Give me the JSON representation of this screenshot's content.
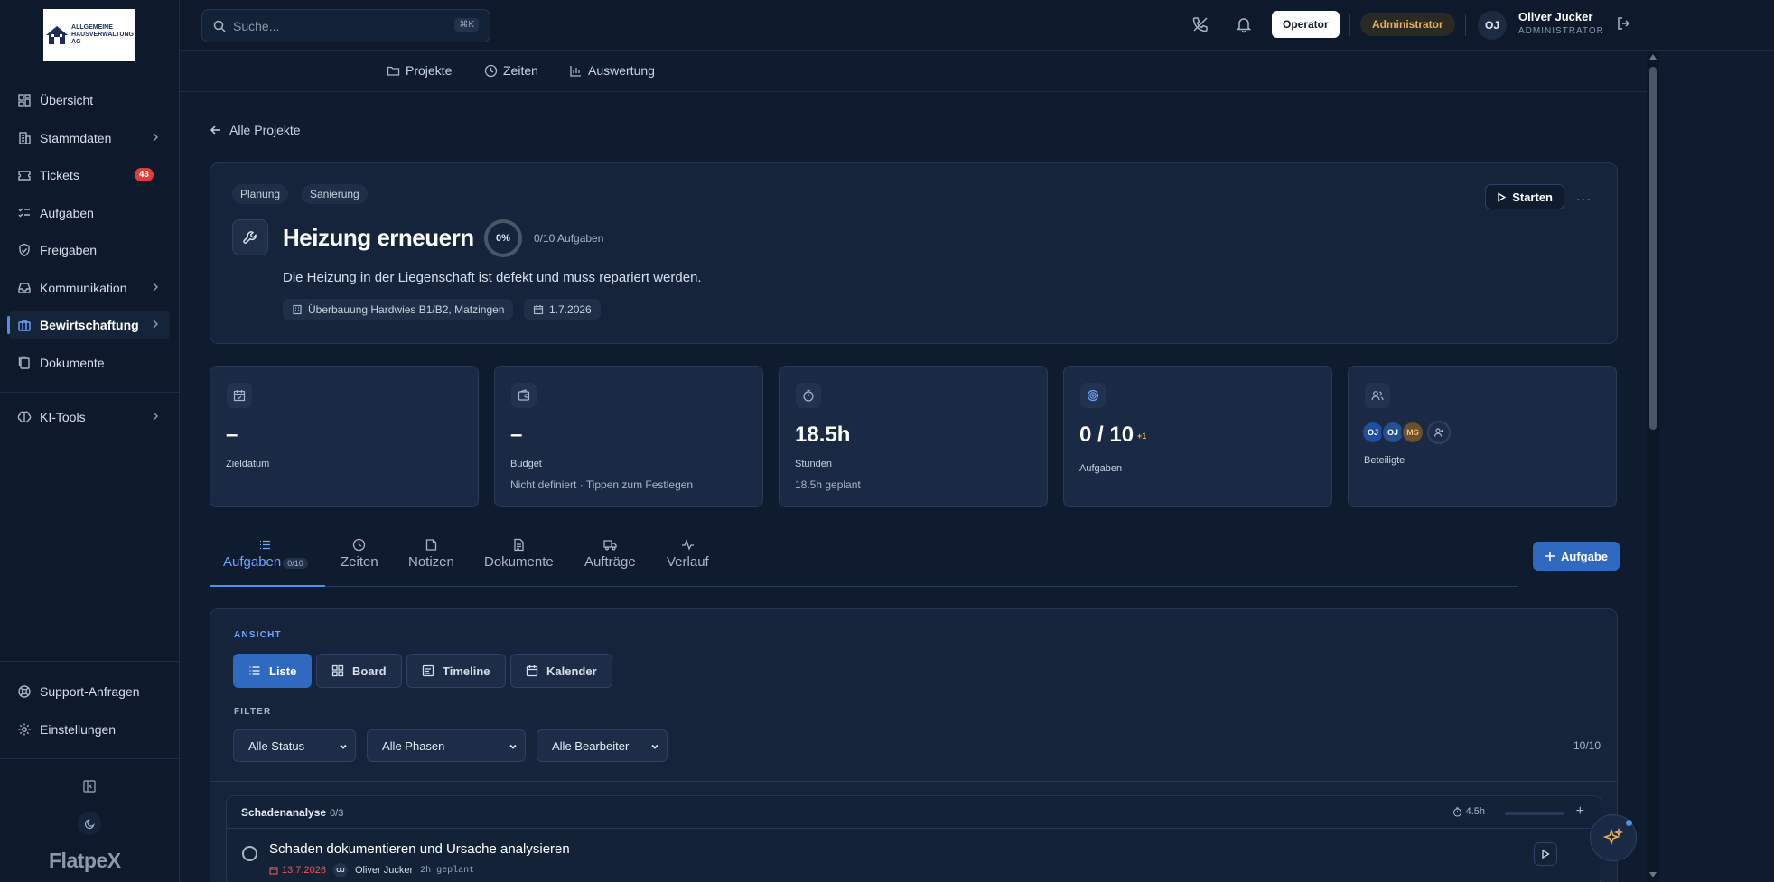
{
  "logo": {
    "line1": "ALLGEMEINE",
    "line2": "HAUSVERWALTUNG",
    "line3": "AG"
  },
  "sidebar": {
    "items": [
      {
        "label": "Übersicht",
        "icon": "dashboard-icon"
      },
      {
        "label": "Stammdaten",
        "icon": "building-icon"
      },
      {
        "label": "Tickets",
        "icon": "ticket-icon",
        "badge": "43"
      },
      {
        "label": "Aufgaben",
        "icon": "task-list-icon"
      },
      {
        "label": "Freigaben",
        "icon": "shield-check-icon"
      },
      {
        "label": "Kommunikation",
        "icon": "inbox-icon"
      },
      {
        "label": "Bewirtschaftung",
        "icon": "briefcase-icon",
        "active": true
      },
      {
        "label": "Dokumente",
        "icon": "documents-icon"
      },
      {
        "label": "KI-Tools",
        "icon": "brain-icon"
      }
    ],
    "bottom": [
      {
        "label": "Support-Anfragen",
        "icon": "lifebuoy-icon"
      },
      {
        "label": "Einstellungen",
        "icon": "gear-icon"
      }
    ],
    "brand": "FlatpeX"
  },
  "topbar": {
    "search_placeholder": "Suche...",
    "search_shortcut": "⌘K",
    "operator_label": "Operator",
    "admin_label": "Administrator",
    "user_initials": "OJ",
    "user_name": "Oliver Jucker",
    "user_role": "ADMINISTRATOR"
  },
  "subnav": [
    {
      "label": "Projekte",
      "icon": "folder-icon"
    },
    {
      "label": "Zeiten",
      "icon": "clock-icon"
    },
    {
      "label": "Auswertung",
      "icon": "bar-chart-icon"
    }
  ],
  "back_label": "Alle Projekte",
  "project": {
    "tags": [
      "Planung",
      "Sanierung"
    ],
    "title": "Heizung erneuern",
    "progress": "0%",
    "progress_value": 0,
    "tasks_count": "0/10 Aufgaben",
    "description": "Die Heizung in der Liegenschaft ist defekt und muss repariert werden.",
    "location": "Überbauung Hardwies B1/B2, Matzingen",
    "date": "1.7.2026",
    "start_label": "Starten",
    "more_label": "···"
  },
  "stats": [
    {
      "value": "–",
      "label": "Zieldatum",
      "sub": "",
      "icon": "calendar-check-icon"
    },
    {
      "value": "–",
      "label": "Budget",
      "sub": "Nicht definiert · Tippen zum Festlegen",
      "icon": "wallet-icon"
    },
    {
      "value": "18.5h",
      "label": "Stunden",
      "sub": "18.5h geplant",
      "icon": "timer-icon"
    },
    {
      "value": "0 / 10",
      "label": "Aufgaben",
      "sub": "",
      "extra": "+1",
      "icon": "target-icon"
    },
    {
      "value": "",
      "label": "Beteiligte",
      "sub": "",
      "icon": "users-icon",
      "avatars": [
        "OJ",
        "OJ",
        "MS"
      ]
    }
  ],
  "tabs": [
    {
      "label": "Aufgaben",
      "count": "0/10",
      "icon": "list-icon",
      "active": true
    },
    {
      "label": "Zeiten",
      "icon": "clock-icon"
    },
    {
      "label": "Notizen",
      "icon": "note-icon"
    },
    {
      "label": "Dokumente",
      "icon": "document-icon"
    },
    {
      "label": "Aufträge",
      "icon": "truck-icon"
    },
    {
      "label": "Verlauf",
      "icon": "activity-icon"
    }
  ],
  "add_task_label": "Aufgabe",
  "panel": {
    "view_label": "ANSICHT",
    "views": [
      "Liste",
      "Board",
      "Timeline",
      "Kalender"
    ],
    "filter_label": "FILTER",
    "filters": [
      "Alle Status",
      "Alle Phasen",
      "Alle Bearbeiter"
    ],
    "filter_count": "10/10"
  },
  "group": {
    "title": "Schadenanalyse",
    "count": "0/3",
    "hours": "4.5h",
    "task": {
      "title": "Schaden dokumentieren und Ursache analysieren",
      "date": "13.7.2026",
      "assignee_initials": "OJ",
      "assignee": "Oliver Jucker",
      "planned": "2h geplant"
    }
  },
  "colors": {
    "accent": "#2f69c0",
    "accent_light": "#6ea6ff",
    "danger": "#e23d3d",
    "warning": "#e8b15c",
    "background": "#0f1c30"
  }
}
